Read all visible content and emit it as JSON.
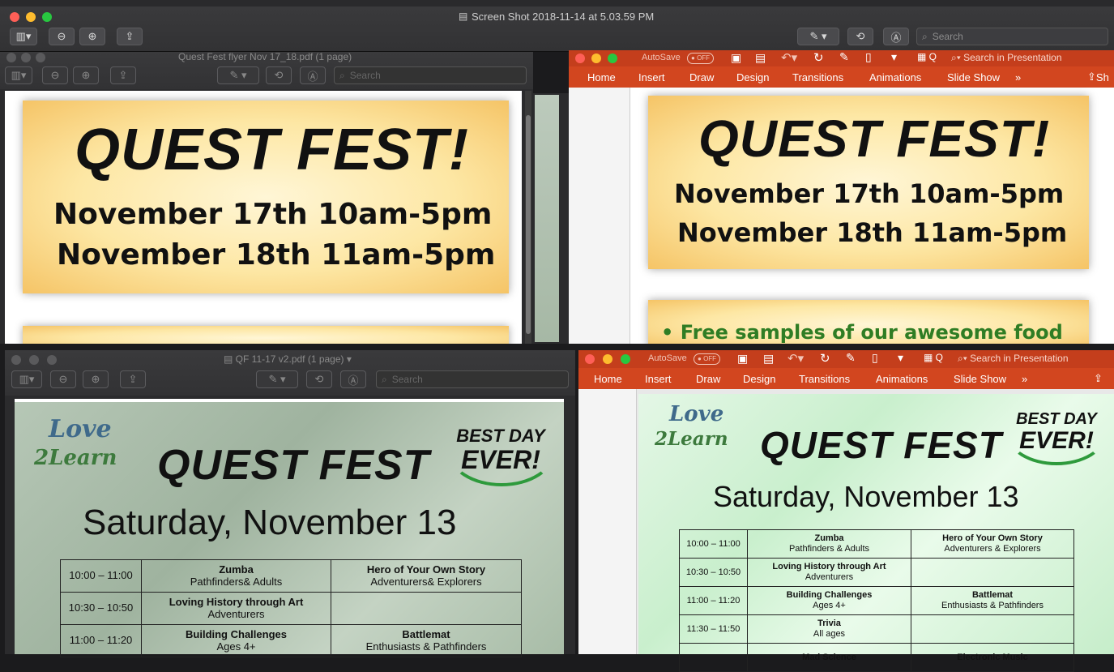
{
  "main_window": {
    "title": "Screen Shot 2018-11-14 at 5.03.59 PM",
    "search_placeholder": "Search"
  },
  "window_tl": {
    "title": "Quest Fest flyer Nov 17_18.pdf (1 page)",
    "search_placeholder": "Search",
    "headline": "QUEST FEST!",
    "date_line_1": "November 17th 10am-5pm",
    "date_line_2": "November 18th 11am-5pm"
  },
  "window_tr": {
    "autosave_label": "AutoSave",
    "autosave_state": "OFF",
    "search_placeholder": "Search in Presentation",
    "tabs": [
      "Home",
      "Insert",
      "Draw",
      "Design",
      "Transitions",
      "Animations",
      "Slide Show"
    ],
    "more_glyph": "»",
    "share_label": "Sh",
    "headline": "QUEST FEST!",
    "date_line_1": "November 17th 10am-5pm",
    "date_line_2": "November 18th 11am-5pm",
    "bullet_text": "Free samples of our awesome food"
  },
  "window_bl": {
    "title": "QF 11-17  v2.pdf (1 page)",
    "search_placeholder": "Search",
    "logo_love": "Love",
    "logo_2learn": "2Learn",
    "headline": "QUEST FEST",
    "badge_line_1": "BEST DAY",
    "badge_line_2": "EVER!",
    "date": "Saturday, November 13",
    "rows": [
      {
        "time": "10:00 – 11:00",
        "a_title": "Zumba",
        "a_sub": "Pathfinders& Adults",
        "b_title": "Hero of Your Own Story",
        "b_sub": "Adventurers& Explorers"
      },
      {
        "time": "10:30 – 10:50",
        "a_title": "Loving History through Art",
        "a_sub": "Adventurers",
        "b_title": "",
        "b_sub": ""
      },
      {
        "time": "11:00 – 11:20",
        "a_title": "Building Challenges",
        "a_sub": "Ages 4+",
        "b_title": "Battlemat",
        "b_sub": "Enthusiasts & Pathfinders"
      }
    ]
  },
  "window_br": {
    "autosave_label": "AutoSave",
    "autosave_state": "OFF",
    "search_placeholder": "Search in Presentation",
    "tabs": [
      "Home",
      "Insert",
      "Draw",
      "Design",
      "Transitions",
      "Animations",
      "Slide Show"
    ],
    "more_glyph": "»",
    "logo_love": "Love",
    "logo_2learn": "2Learn",
    "headline": "QUEST FEST",
    "badge_line_1": "BEST DAY",
    "badge_line_2": "EVER!",
    "date": "Saturday, November 13",
    "rows": [
      {
        "time": "10:00 – 11:00",
        "a_title": "Zumba",
        "a_sub": "Pathfinders & Adults",
        "b_title": "Hero of Your Own Story",
        "b_sub": "Adventurers & Explorers"
      },
      {
        "time": "10:30 – 10:50",
        "a_title": "Loving History through Art",
        "a_sub": "Adventurers",
        "b_title": "",
        "b_sub": ""
      },
      {
        "time": "11:00 – 11:20",
        "a_title": "Building Challenges",
        "a_sub": "Ages 4+",
        "b_title": "Battlemat",
        "b_sub": "Enthusiasts & Pathfinders"
      },
      {
        "time": "11:30 – 11:50",
        "a_title": "Trivia",
        "a_sub": "All ages",
        "b_title": "",
        "b_sub": ""
      },
      {
        "time": "",
        "a_title": "Mad Science",
        "a_sub": "",
        "b_title": "Electronic Music",
        "b_sub": ""
      }
    ]
  },
  "colors": {
    "ppt_ribbon": "#d2461f",
    "close": "#fe5f57",
    "minimize": "#febc2e",
    "zoom": "#28c840",
    "logo_blue": "#3f6a8b",
    "swoosh_green": "#2e9a3c"
  }
}
